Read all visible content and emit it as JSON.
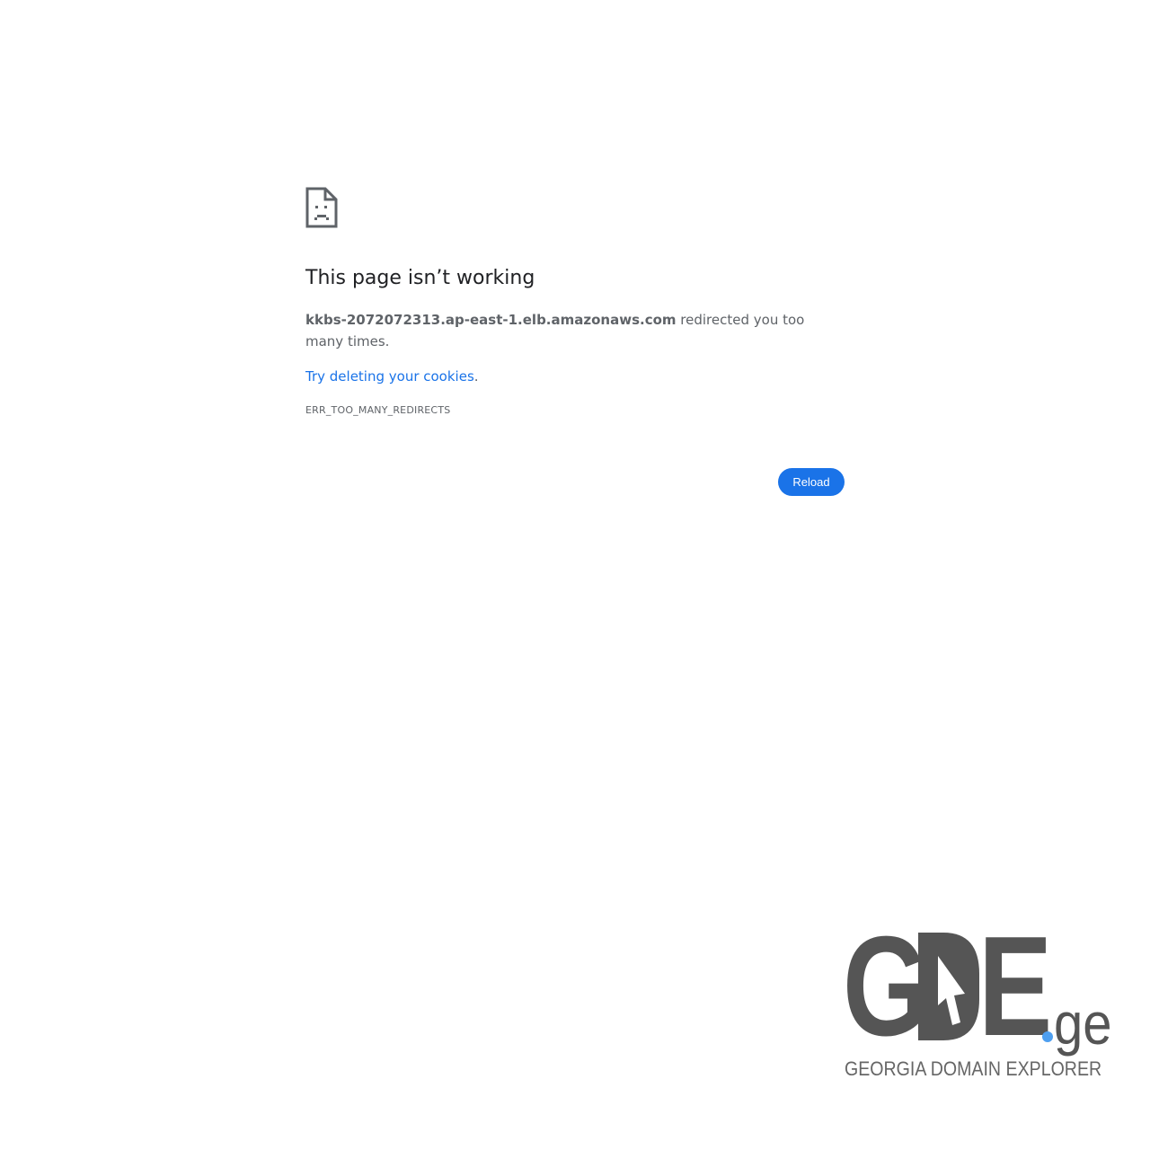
{
  "error_page": {
    "icon": "sad-document-icon",
    "title": "This page isn’t working",
    "host": "kkbs-2072072313.ap-east-1.elb.amazonaws.com",
    "message": " redirected you too many times.",
    "suggestion_link": "Try deleting your cookies",
    "suggestion_suffix": ".",
    "error_code": "ERR_TOO_MANY_REDIRECTS",
    "reload_label": "Reload"
  },
  "logo": {
    "letter_g": "G",
    "letter_d": "D",
    "letter_e": "E",
    "tld": "ge",
    "tagline": "GEORGIA DOMAIN EXPLORER",
    "icon": "cursor-arrow-icon"
  },
  "colors": {
    "accent": "#1a73e8",
    "title_text": "#202124",
    "body_text": "#5f6368",
    "logo_gray": "#555555",
    "logo_dot": "#4e9ff0"
  }
}
